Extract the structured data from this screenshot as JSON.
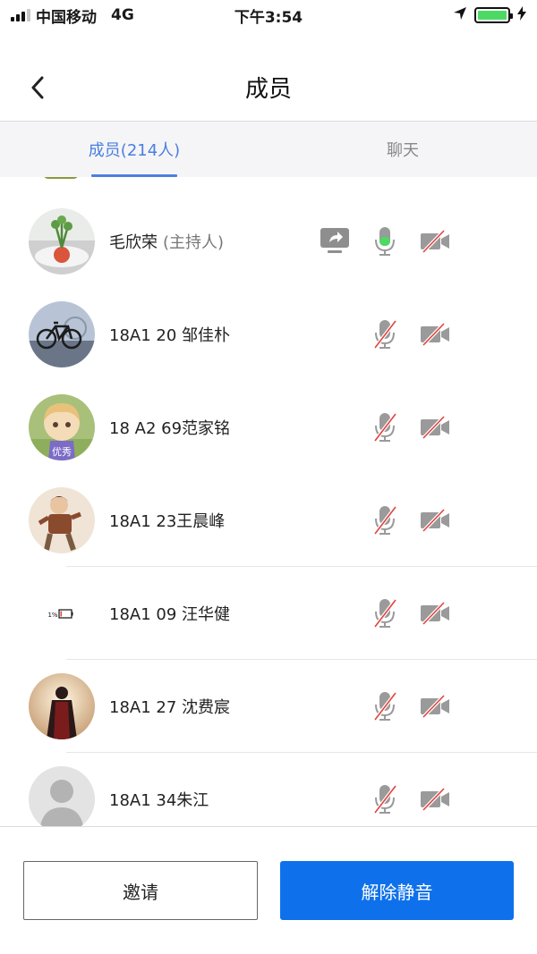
{
  "status_bar": {
    "carrier": "中国移动",
    "network": "4G",
    "time": "下午3:54"
  },
  "nav": {
    "title": "成员"
  },
  "tabs": [
    {
      "label": "成员(214人)",
      "active": true
    },
    {
      "label": "聊天",
      "active": false
    }
  ],
  "participants": [
    {
      "name": "毛欣荣",
      "role": "(主持人)",
      "sharing": true,
      "mic": "active",
      "camera": "off",
      "avatar": "photo"
    },
    {
      "name": " 18A1 20  邹佳朴",
      "role": "",
      "sharing": false,
      "mic": "muted",
      "camera": "off",
      "avatar": "photo"
    },
    {
      "name": "18  A2  69范家铭",
      "role": "",
      "sharing": false,
      "mic": "muted",
      "camera": "off",
      "avatar": "photo",
      "avatar_text": "优秀"
    },
    {
      "name": "18A1   23王晨峰",
      "role": "",
      "sharing": false,
      "mic": "muted",
      "camera": "off",
      "avatar": "photo"
    },
    {
      "name": "18A1 09 汪华健",
      "role": "",
      "sharing": false,
      "mic": "muted",
      "camera": "off",
      "avatar": "battery-image",
      "avatar_text": "1%"
    },
    {
      "name": "18A1 27 沈费宸",
      "role": "",
      "sharing": false,
      "mic": "muted",
      "camera": "off",
      "avatar": "photo"
    },
    {
      "name": "18A1 34朱江",
      "role": "",
      "sharing": false,
      "mic": "muted",
      "camera": "off",
      "avatar": "default-person"
    }
  ],
  "actions": {
    "invite_label": "邀请",
    "unmute_all_label": "解除静音"
  },
  "colors": {
    "accent": "#4a7fe0",
    "primary_button": "#0e71eb",
    "mic_active": "#4cd964",
    "muted_slash": "#e0443e",
    "battery": "#4cd964"
  }
}
